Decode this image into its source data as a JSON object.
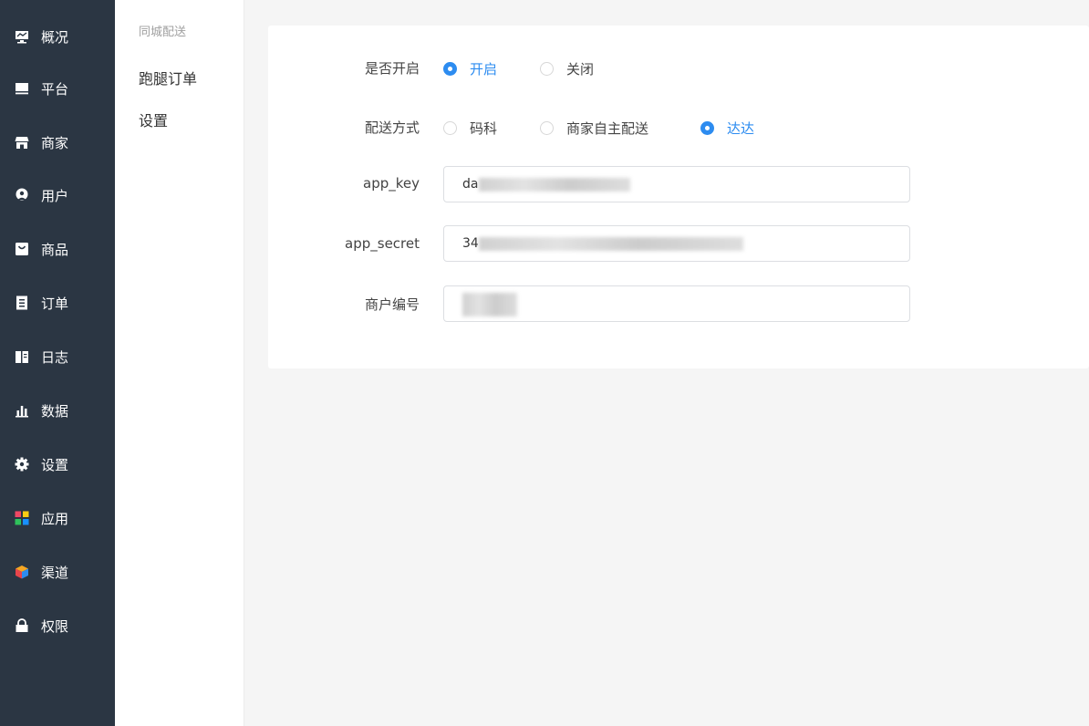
{
  "sidebar": {
    "items": [
      {
        "label": "概况",
        "icon": "monitor-chart-icon"
      },
      {
        "label": "平台",
        "icon": "screen-icon"
      },
      {
        "label": "商家",
        "icon": "store-icon"
      },
      {
        "label": "用户",
        "icon": "user-icon"
      },
      {
        "label": "商品",
        "icon": "shopping-bag-icon"
      },
      {
        "label": "订单",
        "icon": "order-list-icon"
      },
      {
        "label": "日志",
        "icon": "book-icon"
      },
      {
        "label": "数据",
        "icon": "bar-chart-icon"
      },
      {
        "label": "设置",
        "icon": "gear-icon"
      },
      {
        "label": "应用",
        "icon": "apps-grid-icon"
      },
      {
        "label": "渠道",
        "icon": "cube-icon"
      },
      {
        "label": "权限",
        "icon": "lock-icon"
      }
    ]
  },
  "subnav": {
    "title": "同城配送",
    "items": [
      {
        "label": "跑腿订单"
      },
      {
        "label": "设置"
      }
    ]
  },
  "form": {
    "enable": {
      "label": "是否开启",
      "options": [
        {
          "label": "开启",
          "checked": true
        },
        {
          "label": "关闭",
          "checked": false
        }
      ]
    },
    "method": {
      "label": "配送方式",
      "options": [
        {
          "label": "码科",
          "checked": false
        },
        {
          "label": "商家自主配送",
          "checked": false
        },
        {
          "label": "达达",
          "checked": true
        }
      ]
    },
    "app_key": {
      "label": "app_key",
      "value": "da"
    },
    "app_secret": {
      "label": "app_secret",
      "value": "34"
    },
    "merchant_no": {
      "label": "商户编号",
      "value": ""
    }
  },
  "colors": {
    "sidebar_bg": "#2b3643",
    "accent": "#2d8cf0",
    "page_bg": "#f5f5f5"
  }
}
